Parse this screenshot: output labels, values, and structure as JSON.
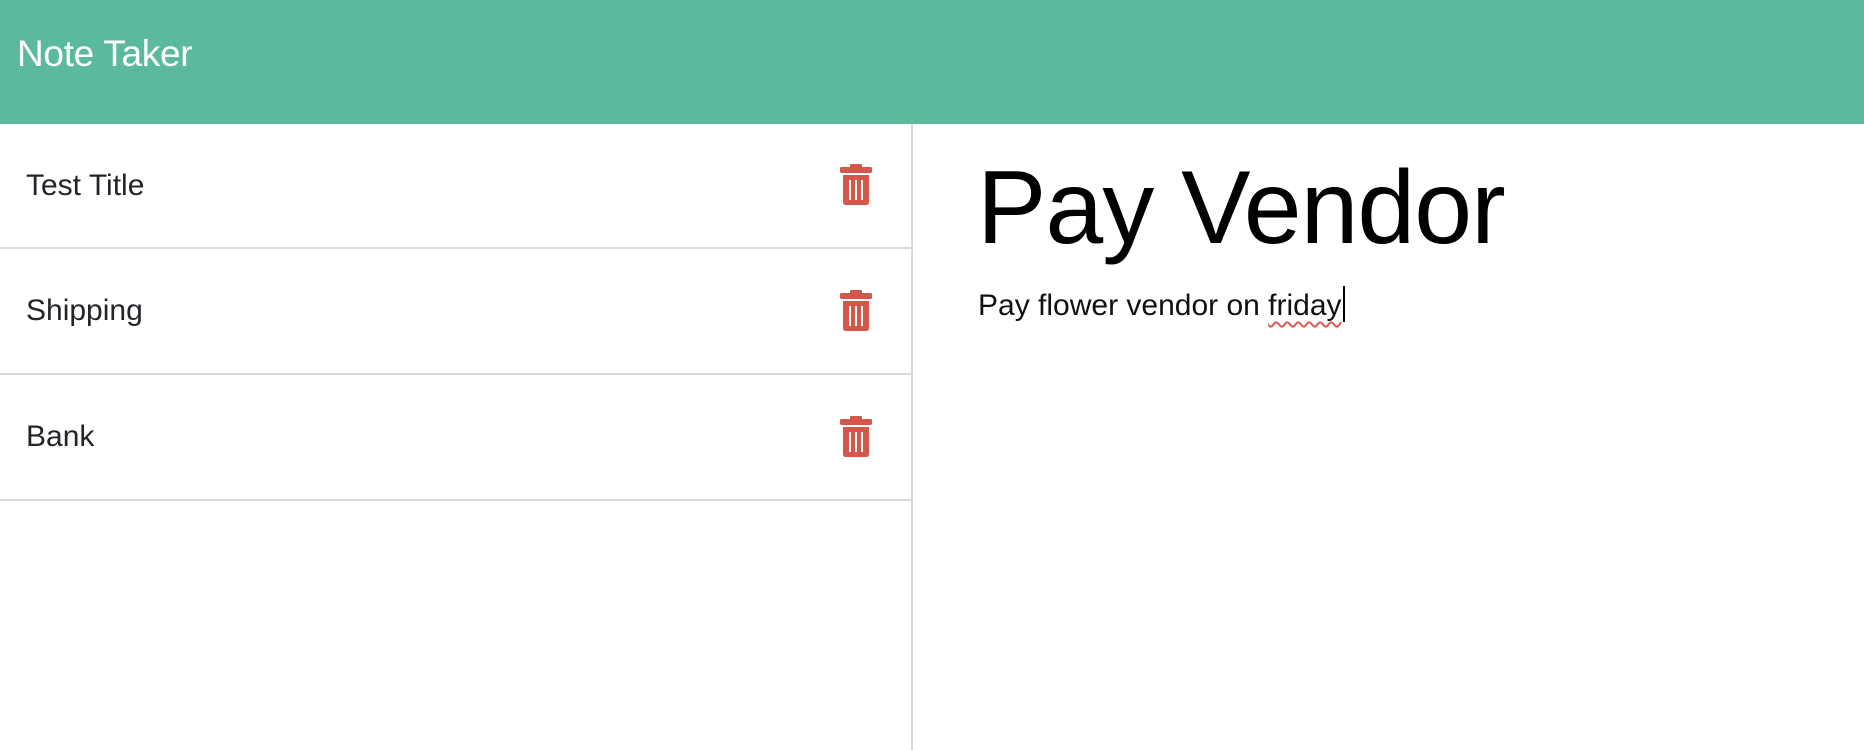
{
  "navbar": {
    "brand": "Note Taker",
    "background_color": "#5bba9d"
  },
  "sidebar": {
    "notes": [
      {
        "title": "Test Title",
        "delete_icon": "trash-icon"
      },
      {
        "title": "Shipping",
        "delete_icon": "trash-icon"
      },
      {
        "title": "Bank",
        "delete_icon": "trash-icon"
      }
    ],
    "delete_icon_color": "#d3574a"
  },
  "editor": {
    "title_value": "Pay Vendor",
    "body_value_prefix": "Pay flower vendor on ",
    "body_value_misspelled": "friday"
  }
}
